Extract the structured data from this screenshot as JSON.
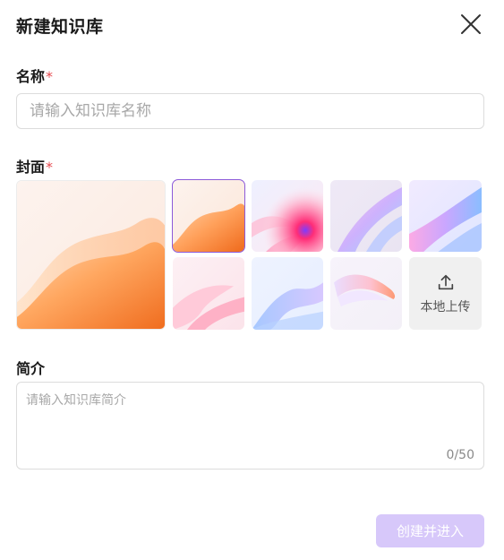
{
  "dialog": {
    "title": "新建知识库",
    "close_icon": "close-icon"
  },
  "name_field": {
    "label": "名称",
    "required_mark": "*",
    "placeholder": "请输入知识库名称",
    "value": ""
  },
  "cover_field": {
    "label": "封面",
    "required_mark": "*",
    "selected_index": 0,
    "options": [
      {
        "id": "orange-wave",
        "selected": true
      },
      {
        "id": "pink-flower",
        "selected": false
      },
      {
        "id": "iridescent-silk",
        "selected": false
      },
      {
        "id": "purple-ribbon",
        "selected": false
      },
      {
        "id": "pink-folds",
        "selected": false
      },
      {
        "id": "blue-wave",
        "selected": false
      },
      {
        "id": "glass-ribbon",
        "selected": false
      }
    ],
    "upload": {
      "label": "本地上传",
      "icon": "upload-icon"
    }
  },
  "intro_field": {
    "label": "简介",
    "placeholder": "请输入知识库简介",
    "value": "",
    "counter": "0/50"
  },
  "footer": {
    "create_label": "创建并进入"
  },
  "colors": {
    "accent": "#8c5ad9",
    "required": "#e5484d",
    "button_disabled_bg": "#d7c8fa",
    "upload_tile_bg": "#f0f0f0"
  }
}
